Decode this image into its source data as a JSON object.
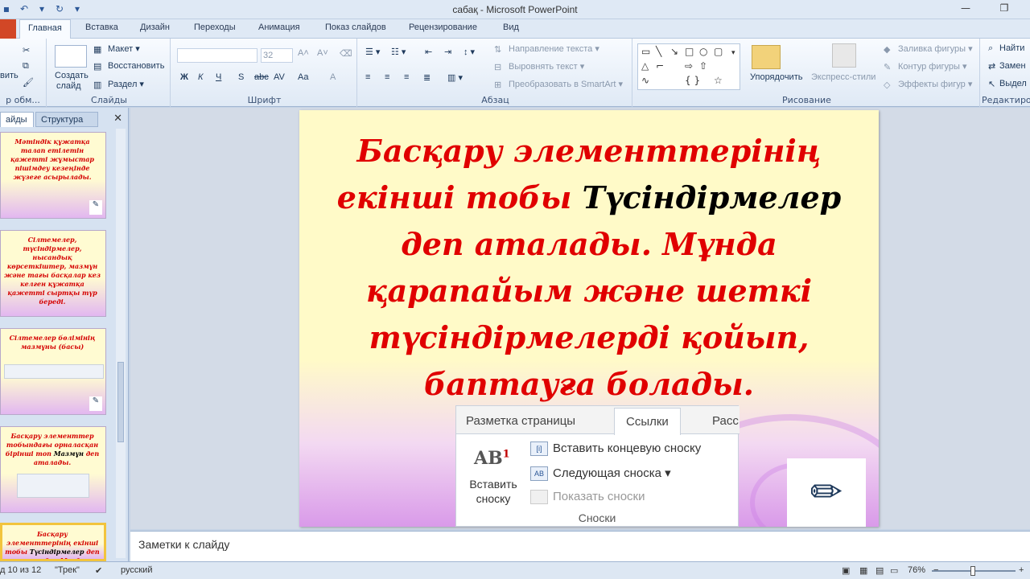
{
  "window": {
    "title": "сабақ  -  Microsoft PowerPoint"
  },
  "ribbon_tabs": [
    "Главная",
    "Вставка",
    "Дизайн",
    "Переходы",
    "Анимация",
    "Показ слайдов",
    "Рецензирование",
    "Вид"
  ],
  "ribbon": {
    "clipboard_label": "р обм...",
    "paste_label": "вить",
    "slides": {
      "create": "Создать",
      "create2": "слайд",
      "layout": "Макет",
      "reset": "Восстановить",
      "section": "Раздел",
      "label": "Слайды"
    },
    "font": {
      "size": "32",
      "label": "Шрифт",
      "bold": "Ж",
      "italic": "К",
      "underline": "Ч",
      "strike": "S",
      "abc": "abc",
      "spacing": "AV",
      "case": "Aa",
      "color": "A"
    },
    "paragraph": {
      "text_dir": "Направление текста",
      "align_text": "Выровнять текст",
      "smartart": "Преобразовать в SmartArt",
      "label": "Абзац"
    },
    "drawing": {
      "arrange": "Упорядочить",
      "quick_styles": "Экспресс-стили",
      "fill": "Заливка фигуры",
      "outline": "Контур фигуры",
      "effects": "Эффекты фигур",
      "label": "Рисование"
    },
    "editing": {
      "find": "Найти",
      "replace": "Замен",
      "select": "Выдел",
      "label": "Редактирован"
    }
  },
  "left_pane": {
    "tab_slides": "айды",
    "tab_outline": "Структура",
    "thumbs": [
      {
        "text": "Мәтіндік құжатқа талап етілетін қажетті жұмыстар пішімдеу кезеңінде жүзеге асырылады."
      },
      {
        "text": "Сілтемелер, түсіндірмелер, нысандық көрсеткіштер, мазмұн және тағы басқалар кез келген құжатқа қажетті сыртқы түр береді."
      },
      {
        "text": "Сілтемелер бөлімінің мазмұны (басы)"
      },
      {
        "text": "Басқару элементтер тобындағы орналасқан бірінші топ",
        "bold": "Мазмұн",
        "tail": "деп аталады."
      },
      {
        "text": "Басқару элементтерінің екінші тобы",
        "bold": "Түсіндірмелер",
        "tail": "деп аталады. Мұнда қарапайым және шетк"
      }
    ]
  },
  "slide": {
    "line1": "Басқару элементтерінің",
    "line2a": "екінші тобы ",
    "line2b": "Түсіндірмелер",
    "line3": "деп аталады. Мұнда",
    "line4": "қарапайым және шеткі",
    "line5": "түсіндірмелерді қойып,",
    "line6": "баптауға болады.",
    "embedded": {
      "tab1": "Разметка страницы",
      "tab2": "Ссылки",
      "tab3": "Расс",
      "button": "Вставить сноску",
      "btn_l1": "Вставить",
      "btn_l2": "сноску",
      "insert_endnote": "Вставить концевую сноску",
      "next_footnote": "Следующая сноска",
      "show_notes": "Показать сноски",
      "group": "Сноски"
    }
  },
  "notes": {
    "placeholder": "Заметки к слайду"
  },
  "status": {
    "slide": "д 10 из 12",
    "theme": "\"Трек\"",
    "lang": "русский",
    "zoom": "76%"
  }
}
